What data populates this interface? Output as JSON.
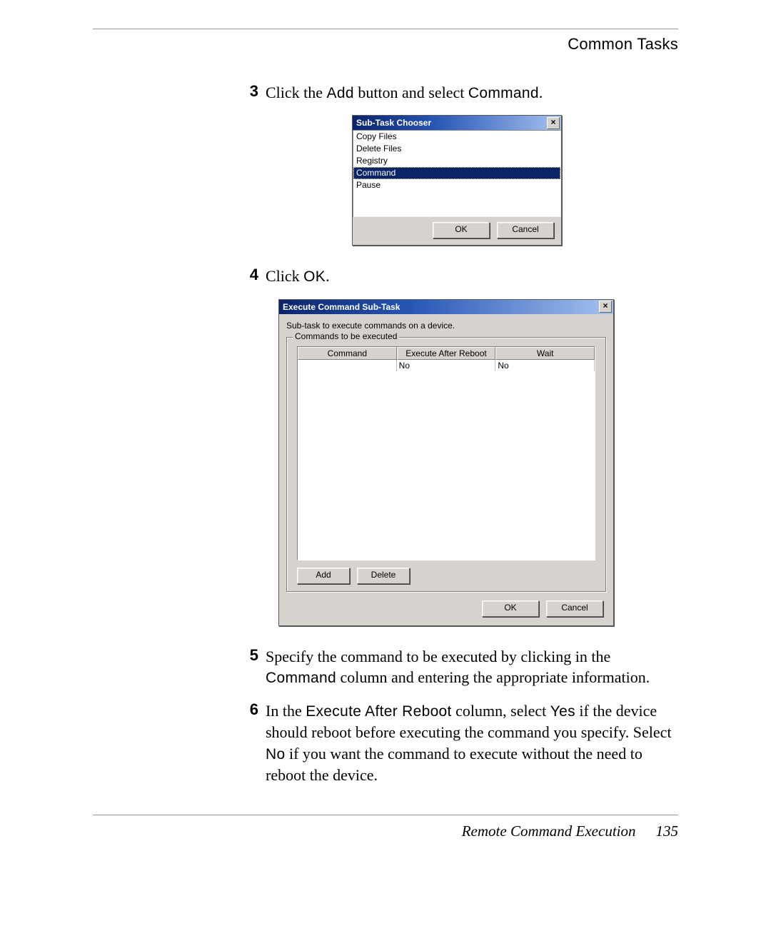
{
  "header": {
    "title": "Common Tasks"
  },
  "steps": {
    "s3": {
      "num": "3",
      "pre": "Click the ",
      "add": "Add",
      "mid": " button and select ",
      "cmd": "Command",
      "post": "."
    },
    "s4": {
      "num": "4",
      "pre": "Click ",
      "ok": "OK",
      "post": "."
    },
    "s5": {
      "num": "5",
      "pre": "Specify the command to be executed by clicking in the ",
      "col": "Command",
      "post": " column and entering the appropriate information."
    },
    "s6": {
      "num": "6",
      "p1": "In the ",
      "col": "Execute After Reboot",
      "p2": " column, select ",
      "yes": "Yes",
      "p3": " if the device should reboot before executing the command you specify. Select ",
      "no": "No",
      "p4": " if you want the command to execute without the need to reboot the device."
    }
  },
  "dialog1": {
    "title": "Sub-Task Chooser",
    "closeGlyph": "×",
    "items": [
      "Copy Files",
      "Delete Files",
      "Registry",
      "Command",
      "Pause"
    ],
    "selectedIndex": 3,
    "ok": "OK",
    "cancel": "Cancel"
  },
  "dialog2": {
    "title": "Execute Command Sub-Task",
    "closeGlyph": "×",
    "desc": "Sub-task to execute commands on a device.",
    "group": "Commands to be executed",
    "columns": [
      "Command",
      "Execute After Reboot",
      "Wait"
    ],
    "row0": {
      "c0": "",
      "c1": "No",
      "c2": "No"
    },
    "add": "Add",
    "delete": "Delete",
    "ok": "OK",
    "cancel": "Cancel"
  },
  "footer": {
    "section": "Remote Command Execution",
    "page": "135"
  }
}
